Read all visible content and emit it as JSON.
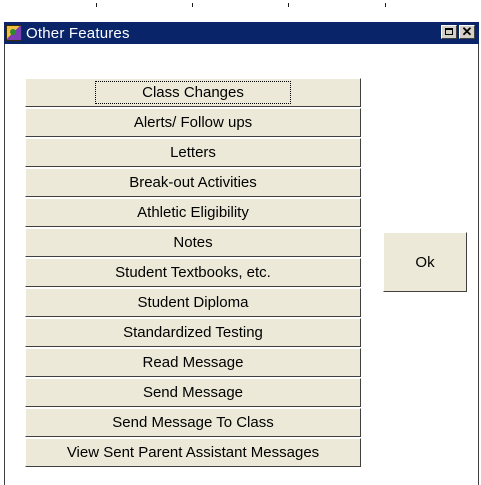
{
  "window": {
    "title": "Other Features",
    "title_bar_color": "#0a246a",
    "app_icon": "app-icon",
    "controls": [
      "maximize-icon",
      "close-icon"
    ]
  },
  "features": [
    {
      "label": "Class Changes",
      "focused": true
    },
    {
      "label": "Alerts/ Follow ups"
    },
    {
      "label": "Letters"
    },
    {
      "label": "Break-out Activities"
    },
    {
      "label": "Athletic Eligibility"
    },
    {
      "label": "Notes"
    },
    {
      "label": "Student Textbooks, etc."
    },
    {
      "label": "Student Diploma"
    },
    {
      "label": "Standardized Testing"
    },
    {
      "label": "Read Message"
    },
    {
      "label": "Send Message"
    },
    {
      "label": "Send Message To Class"
    },
    {
      "label": "View Sent Parent Assistant Messages"
    }
  ],
  "ok_button": {
    "label": "Ok"
  },
  "colors": {
    "button_face": "#ece9d8",
    "window_bg": "#ffffff"
  }
}
